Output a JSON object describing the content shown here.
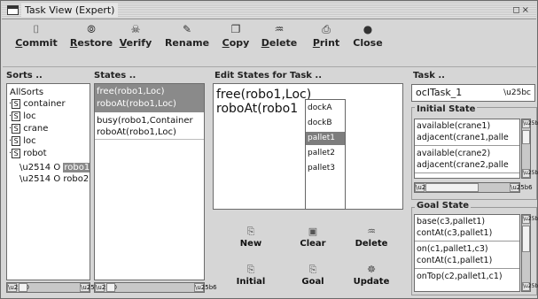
{
  "window": {
    "title": "Task View (Expert)",
    "controls": "◻×"
  },
  "toolbar": [
    {
      "name": "commit",
      "label": "Commit",
      "u": "C",
      "rest": "ommit",
      "icon": "⌷"
    },
    {
      "name": "restore",
      "label": "Restore",
      "u": "R",
      "rest": "estore",
      "icon": "⦾"
    },
    {
      "name": "verify",
      "label": "Verify",
      "u": "V",
      "rest": "erify",
      "icon": "☠"
    },
    {
      "name": "rename",
      "label": "Rename",
      "u": "",
      "rest": "Rename",
      "icon": "✎"
    },
    {
      "name": "copy",
      "label": "Copy",
      "u": "C",
      "rest": "opy",
      "icon": "❐"
    },
    {
      "name": "delete",
      "label": "Delete",
      "u": "D",
      "rest": "elete",
      "icon": "♒"
    },
    {
      "name": "print",
      "label": "Print",
      "u": "P",
      "rest": "rint",
      "icon": "⎙"
    },
    {
      "name": "close",
      "label": "Close",
      "u": "",
      "rest": "Close",
      "icon": "●"
    }
  ],
  "sorts": {
    "title": "Sorts ..",
    "root": "AllSorts",
    "items": [
      "container",
      "loc",
      "crane",
      "loc",
      "robot"
    ],
    "objects": [
      "robo1",
      "robo2"
    ],
    "selected_object": "robo1"
  },
  "states": {
    "title": "States ..",
    "group1": [
      "free(robo1,Loc)",
      "roboAt(robo1,Loc)"
    ],
    "group2": [
      "busy(robo1,Container",
      "roboAt(robo1,Loc)"
    ]
  },
  "edit": {
    "title": "Edit States for Task ..",
    "lines": [
      "free(robo1,Loc)",
      "roboAt(robo1"
    ],
    "dropdown": [
      "dockA",
      "dockB",
      "pallet1",
      "pallet2",
      "pallet3"
    ],
    "dropdown_selected": "pallet1",
    "buttons": [
      {
        "name": "new",
        "label": "New",
        "icon": "⎘"
      },
      {
        "name": "clear",
        "label": "Clear",
        "icon": "▣"
      },
      {
        "name": "delete",
        "label": "Delete",
        "icon": "♒"
      },
      {
        "name": "initial",
        "label": "Initial",
        "icon": "⎘"
      },
      {
        "name": "goal",
        "label": "Goal",
        "icon": "⎘"
      },
      {
        "name": "update",
        "label": "Update",
        "icon": "☸"
      }
    ]
  },
  "task": {
    "title": "Task ..",
    "selected": "ocITask_1",
    "initial_title": "Initial State",
    "initial_rows": [
      [
        "available(crane1)",
        "adjacent(crane1,palle"
      ],
      [
        "available(crane2)",
        "adjacent(crane2,palle"
      ]
    ],
    "goal_title": "Goal State",
    "goal_rows": [
      [
        "base(c3,pallet1)",
        "contAt(c3,pallet1)"
      ],
      [
        "on(c1,pallet1,c3)",
        "contAt(c1,pallet1)"
      ],
      [
        "onTop(c2,pallet1,c1)",
        ""
      ]
    ]
  }
}
